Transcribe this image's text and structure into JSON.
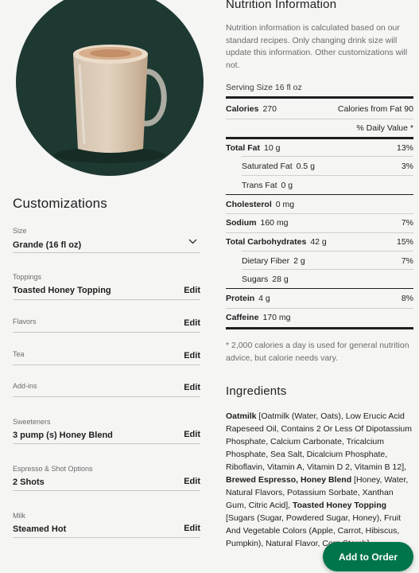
{
  "customizations": {
    "title": "Customizations",
    "size": {
      "label": "Size",
      "value": "Grande (16 fl oz)"
    },
    "fields": [
      {
        "label": "Toppings",
        "value": "Toasted Honey Topping",
        "action": "Edit"
      },
      {
        "label": "Flavors",
        "value": "",
        "action": "Edit"
      },
      {
        "label": "Tea",
        "value": "",
        "action": "Edit"
      },
      {
        "label": "Add-ins",
        "value": "",
        "action": "Edit"
      },
      {
        "label": "Sweeteners",
        "value": "3 pump (s) Honey Blend",
        "action": "Edit"
      },
      {
        "label": "Espresso & Shot Options",
        "value": "2 Shots",
        "action": "Edit"
      },
      {
        "label": "Milk",
        "value": "Steamed Hot",
        "action": "Edit"
      }
    ]
  },
  "nutrition": {
    "title": "Nutrition Information",
    "description": "Nutrition information is calculated based on our standard recipes. Only changing drink size will update this information. Other customizations will not.",
    "serving_size": "Serving Size 16 fl oz",
    "calories_label": "Calories",
    "calories_value": "270",
    "calories_from_fat": "Calories from Fat 90",
    "daily_value_header": "% Daily Value *",
    "rows": [
      {
        "name": "Total Fat",
        "amount": "10 g",
        "dv": "13%",
        "bold": true,
        "indent": false
      },
      {
        "name": "Saturated Fat",
        "amount": "0.5 g",
        "dv": "3%",
        "bold": false,
        "indent": true
      },
      {
        "name": "Trans Fat",
        "amount": "0 g",
        "dv": "",
        "bold": false,
        "indent": true
      },
      {
        "name": "Cholesterol",
        "amount": "0 mg",
        "dv": "",
        "bold": true,
        "indent": false
      },
      {
        "name": "Sodium",
        "amount": "160 mg",
        "dv": "7%",
        "bold": true,
        "indent": false
      },
      {
        "name": "Total Carbohydrates",
        "amount": "42 g",
        "dv": "15%",
        "bold": true,
        "indent": false
      },
      {
        "name": "Dietary Fiber",
        "amount": "2 g",
        "dv": "7%",
        "bold": false,
        "indent": true
      },
      {
        "name": "Sugars",
        "amount": "28 g",
        "dv": "",
        "bold": false,
        "indent": true
      },
      {
        "name": "Protein",
        "amount": "4 g",
        "dv": "8%",
        "bold": true,
        "indent": false
      },
      {
        "name": "Caffeine",
        "amount": "170 mg",
        "dv": "",
        "bold": true,
        "indent": false
      }
    ],
    "footnote": "* 2,000 calories a day is used for general nutrition advice, but calorie needs vary."
  },
  "ingredients": {
    "title": "Ingredients",
    "parts": [
      {
        "text": "Oatmilk",
        "bold": true
      },
      {
        "text": " [Oatmilk (Water, Oats), Low Erucic Acid Rapeseed Oil, Contains 2 Or Less Of Dipotassium Phosphate, Calcium Carbonate, Tricalcium Phosphate, Sea Salt, Dicalcium Phosphate, Riboflavin, Vitamin A, Vitamin D 2, Vitamin B 12], ",
        "bold": false
      },
      {
        "text": "Brewed Espresso, Honey Blend",
        "bold": true
      },
      {
        "text": " [Honey, Water, Natural Flavors, Potassium Sorbate, Xanthan Gum, Citric Acid], ",
        "bold": false
      },
      {
        "text": "Toasted Honey Topping",
        "bold": true
      },
      {
        "text": " [Sugars (Sugar, Powdered Sugar, Honey), Fruit And Vegetable Colors (Apple, Carrot, Hibiscus, Pumpkin), Natural Flavor, Corn Starch]",
        "bold": false
      }
    ]
  },
  "order_button": {
    "label": "Add to Order"
  },
  "colors": {
    "hero_background": "#1e3932",
    "button_green": "#00754a",
    "page_background": "#f5f5f4"
  }
}
